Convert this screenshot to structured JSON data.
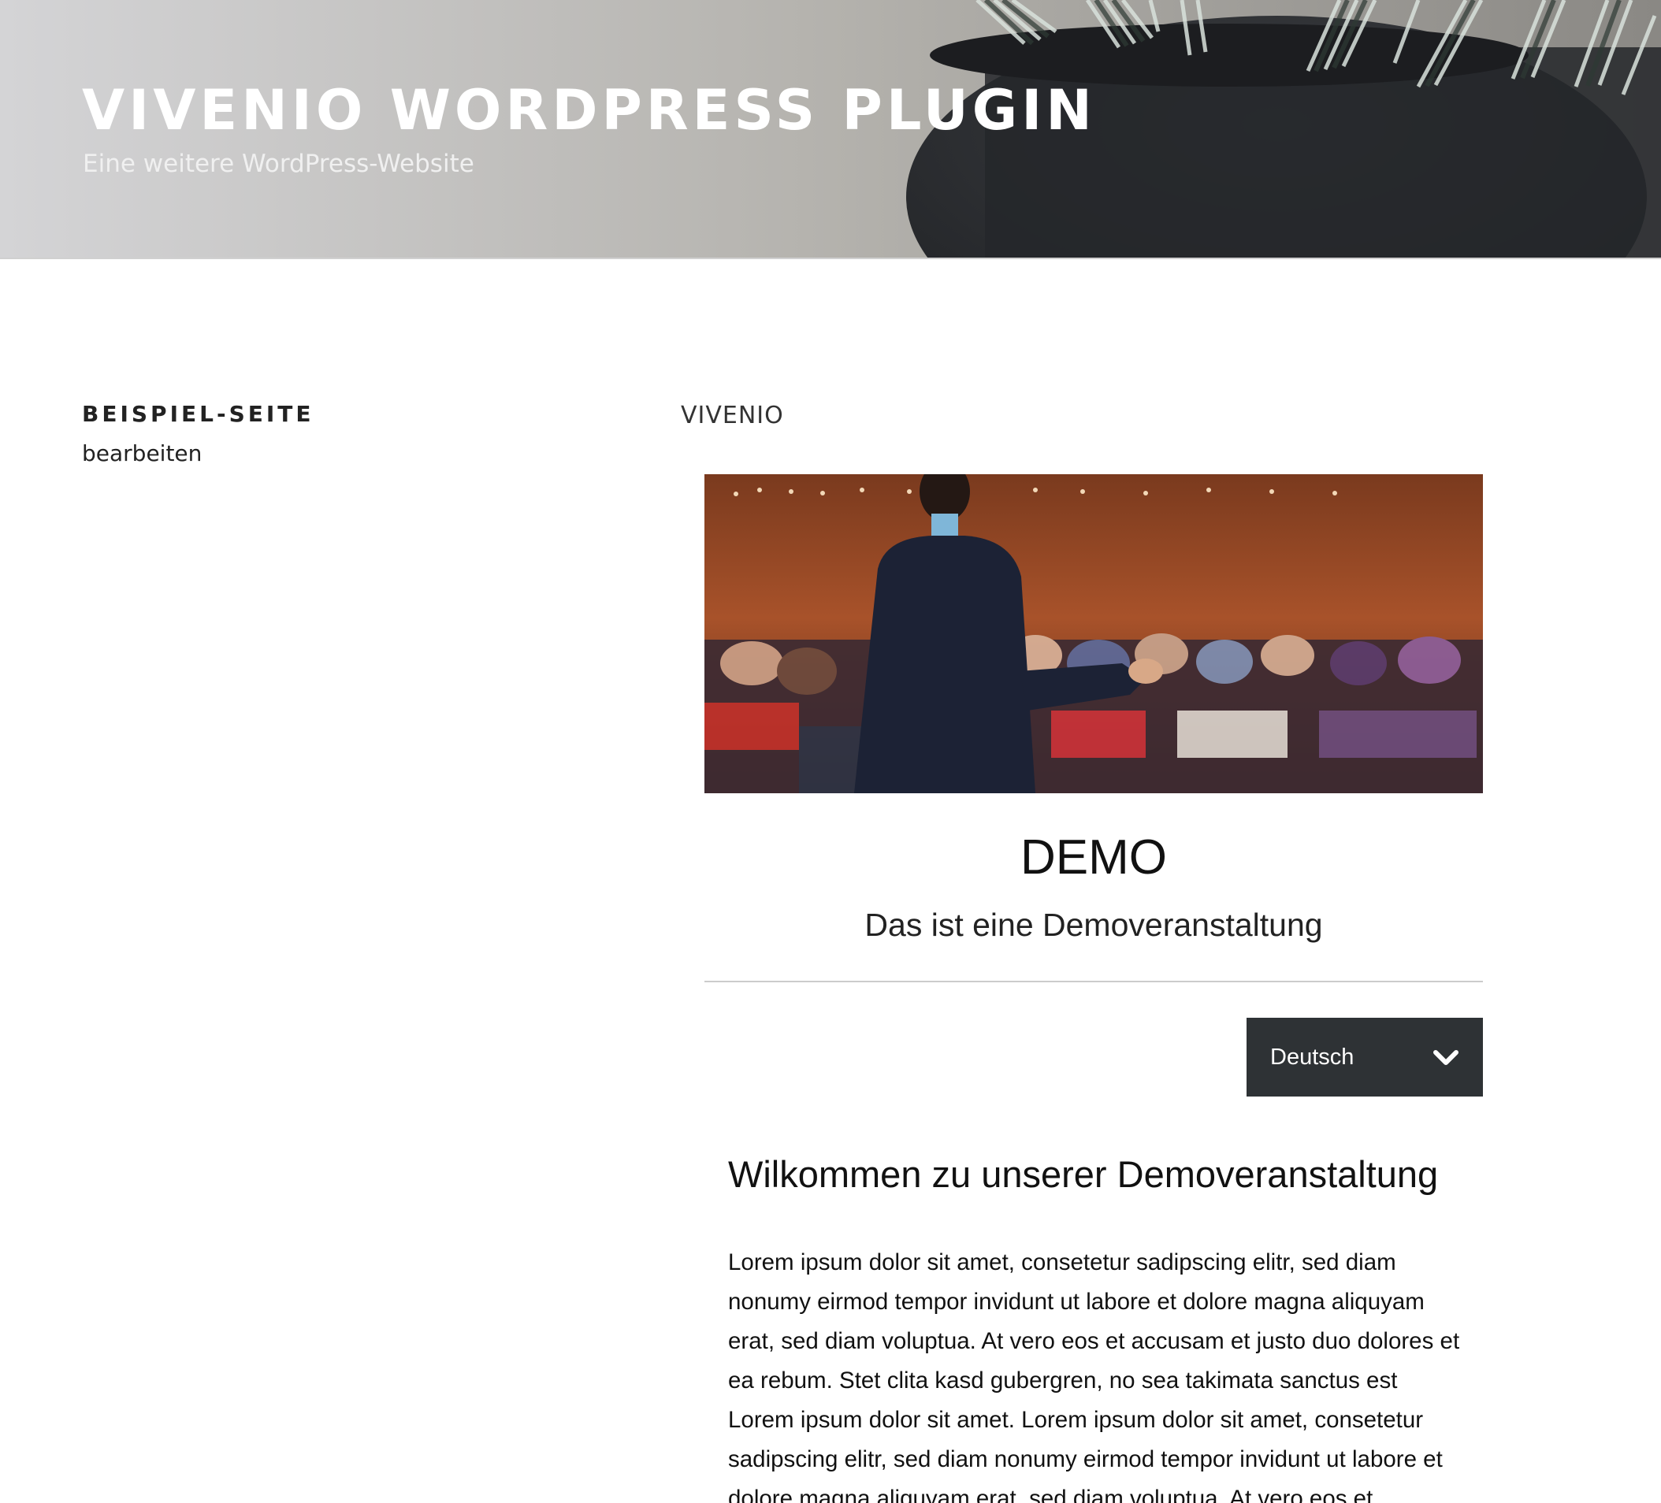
{
  "header": {
    "site_title": "VIVENIO WORDPRESS PLUGIN",
    "site_description": "Eine weitere WordPress-Website"
  },
  "sidebar": {
    "page_title": "BEISPIEL-SEITE",
    "edit_label": "bearbeiten"
  },
  "main": {
    "section_label": "VIVENIO",
    "event": {
      "title": "DEMO",
      "subtitle": "Das ist eine Demoveranstaltung"
    },
    "language_select": {
      "selected": "Deutsch",
      "icon": "chevron-down-icon"
    },
    "welcome_heading": "Wilkommen zu unserer Demoveranstaltung",
    "body_text": "Lorem ipsum dolor sit amet, consetetur sadipscing elitr, sed diam nonumy eirmod tempor invidunt ut labore et dolore magna aliquyam erat, sed diam voluptua. At vero eos et accusam et justo duo dolores et ea rebum. Stet clita kasd gubergren, no sea takimata sanctus est Lorem ipsum dolor sit amet. Lorem ipsum dolor sit amet, consetetur sadipscing elitr, sed diam nonumy eirmod tempor invidunt ut labore et dolore magna aliquyam erat, sed diam voluptua. At vero eos et accusam et justo duo"
  },
  "colors": {
    "select_background": "#2e3235",
    "text": "#111111",
    "divider": "#cccccc"
  }
}
